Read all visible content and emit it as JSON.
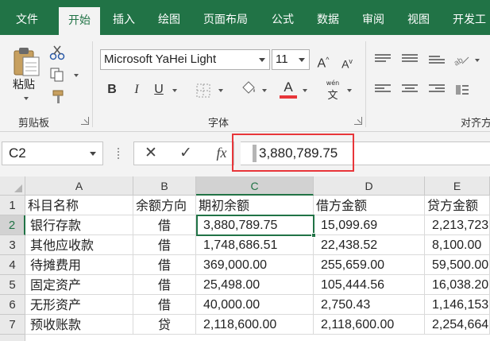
{
  "tabs": [
    "文件",
    "开始",
    "插入",
    "绘图",
    "页面布局",
    "公式",
    "数据",
    "审阅",
    "视图",
    "开发工"
  ],
  "active_tab": "开始",
  "ribbon": {
    "paste_label": "粘贴",
    "clipboard_label": "剪贴板",
    "font_label": "字体",
    "alignment_label": "对齐方",
    "font_name": "Microsoft YaHei Light",
    "font_size": "11",
    "bold": "B",
    "italic": "I",
    "underline": "U",
    "grow_font": "A",
    "shrink_font": "A",
    "font_color_letter": "A",
    "phonetic": "wén",
    "font_color": "#e8363a"
  },
  "formula_bar": {
    "name_box": "C2",
    "cancel": "✕",
    "enter": "✓",
    "fx": "fx",
    "value": "3,880,789.75"
  },
  "grid": {
    "columns": [
      "A",
      "B",
      "C",
      "D",
      "E"
    ],
    "selected_column": "C",
    "rows": [
      "1",
      "2",
      "3",
      "4",
      "5",
      "6",
      "7"
    ],
    "selected_row": "2",
    "cells": [
      [
        "科目名称",
        "余额方向",
        "期初余额",
        "借方金额",
        "贷方金额"
      ],
      [
        "银行存款",
        "借",
        "3,880,789.75",
        "15,099.69",
        "2,213,723"
      ],
      [
        "其他应收款",
        "借",
        "1,748,686.51",
        "22,438.52",
        "8,100.00"
      ],
      [
        "待摊费用",
        "借",
        "369,000.00",
        "255,659.00",
        "59,500.00"
      ],
      [
        "固定资产",
        "借",
        "25,498.00",
        "105,444.56",
        "16,038.20"
      ],
      [
        "无形资产",
        "借",
        "40,000.00",
        "2,750.43",
        "1,146,153."
      ],
      [
        "预收账款",
        "贷",
        "2,118,600.00",
        "2,118,600.00",
        "2,254,664"
      ]
    ]
  },
  "colors": {
    "brand_green": "#217346",
    "highlight_red": "#e8363a"
  }
}
